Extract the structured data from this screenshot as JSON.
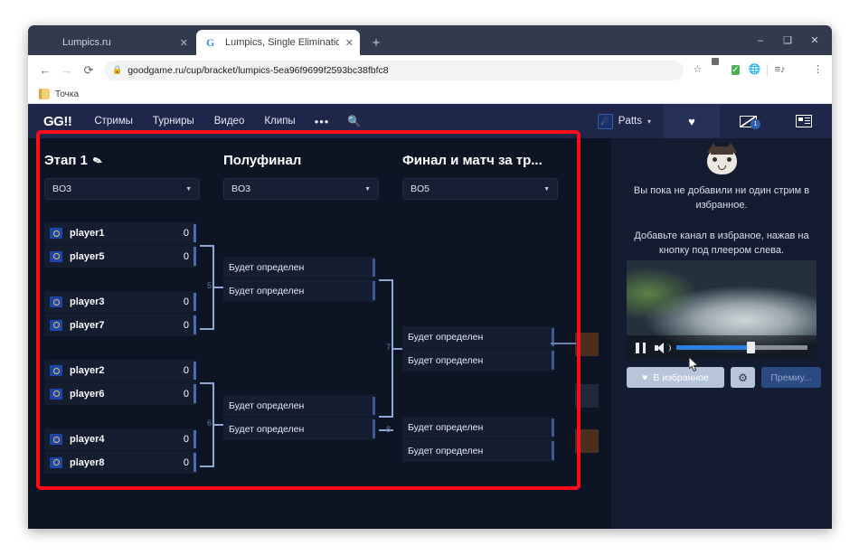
{
  "browser": {
    "tabs": [
      {
        "title": "Lumpics.ru",
        "favicon": "orange-dot-icon",
        "active": false
      },
      {
        "title": "Lumpics, Single Elimination — ",
        "title_faded": "re",
        "favicon": "google-g-icon",
        "active": true
      }
    ],
    "new_tab_label": "+",
    "close_label": "✕",
    "window_controls": {
      "minimize": "–",
      "maximize": "❑",
      "close": "✕"
    },
    "nav": {
      "back": "←",
      "forward": "→",
      "reload": "⟳"
    },
    "omnibox": {
      "url": "goodgame.ru/cup/bracket/lumpics-5ea96f9699f2593bc38fbfc8",
      "lock": "🔒"
    },
    "toolbar_icons": [
      "star-icon",
      "adblock-extension-icon",
      "checkmark-extension-icon",
      "globe-extension-icon",
      "reading-list-icon",
      "profile-avatar-icon",
      "chrome-menu-icon"
    ],
    "bookmarks": [
      {
        "label": "Точка",
        "icon": "note-icon"
      }
    ]
  },
  "site": {
    "logo": "GG!!",
    "nav_items": [
      "Стримы",
      "Турниры",
      "Видео",
      "Клипы"
    ],
    "more_label": "•••",
    "search_label": "🔍",
    "user": {
      "name": "Patts",
      "caret": "▾"
    },
    "mail_badge": "1"
  },
  "bracket": {
    "columns": [
      {
        "title": "Этап 1",
        "has_edit_icon": true,
        "format": "BO3"
      },
      {
        "title": "Полуфинал",
        "has_edit_icon": false,
        "format": "BO3"
      },
      {
        "title": "Финал и матч за тр...",
        "has_edit_icon": false,
        "format": "BO5"
      }
    ],
    "round1": [
      {
        "id": "m1",
        "slots": [
          {
            "name": "player1",
            "score": "0"
          },
          {
            "name": "player5",
            "score": "0"
          }
        ]
      },
      {
        "id": "m2",
        "slots": [
          {
            "name": "player3",
            "score": "0"
          },
          {
            "name": "player7",
            "score": "0"
          }
        ]
      },
      {
        "id": "m3",
        "slots": [
          {
            "name": "player2",
            "score": "0"
          },
          {
            "name": "player6",
            "score": "0"
          }
        ]
      },
      {
        "id": "m4",
        "slots": [
          {
            "name": "player4",
            "score": "0"
          },
          {
            "name": "player8",
            "score": "0"
          }
        ]
      }
    ],
    "semifinals": [
      {
        "id": "m5",
        "number": "5",
        "slots": [
          {
            "name": "Будет определен"
          },
          {
            "name": "Будет определен"
          }
        ]
      },
      {
        "id": "m6",
        "number": "6",
        "slots": [
          {
            "name": "Будет определен"
          },
          {
            "name": "Будет определен"
          }
        ]
      }
    ],
    "finals": [
      {
        "id": "m7",
        "number": "7",
        "slots": [
          {
            "name": "Будет определен"
          },
          {
            "name": "Будет определен"
          }
        ]
      },
      {
        "id": "m8",
        "number": "8",
        "slots": [
          {
            "name": "Будет определен"
          },
          {
            "name": "Будет определен"
          }
        ]
      }
    ]
  },
  "sidebar": {
    "empty_title": "Вы пока не добавили ни один стрим в избранное.",
    "empty_hint": "Добавьте канал в избраное, нажав на кнопку под плеером слева.",
    "player": {
      "pause_label": "‖",
      "volume_percent": 58
    },
    "favorite_button": "В избранное",
    "heart_icon": "♥",
    "gear_icon": "⚙",
    "premium_button": "Премиу..."
  },
  "annotation": {
    "color": "#fc0d1b"
  }
}
